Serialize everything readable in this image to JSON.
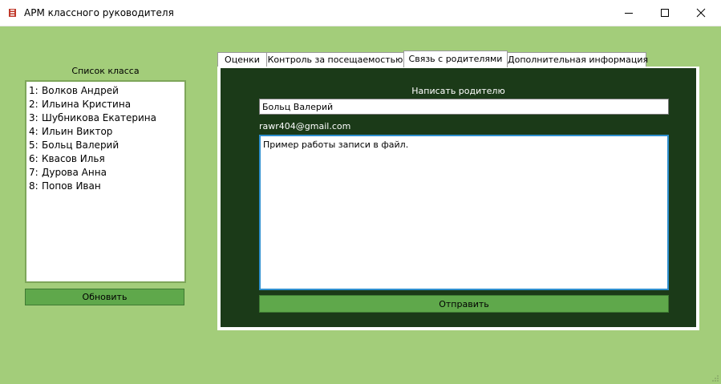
{
  "window": {
    "title": "АРМ классного руководителя",
    "controls": {
      "minimize": "minimize-icon",
      "maximize": "maximize-icon",
      "close": "close-icon"
    }
  },
  "left_panel": {
    "list_title": "Список класса",
    "students": [
      {
        "num": "1:",
        "name": "Волков Андрей"
      },
      {
        "num": "2:",
        "name": "Ильина Кристина"
      },
      {
        "num": "3:",
        "name": "Шубникова Екатерина"
      },
      {
        "num": "4:",
        "name": "Ильин Виктор"
      },
      {
        "num": "5:",
        "name": "Больц Валерий"
      },
      {
        "num": "6:",
        "name": "Квасов Илья"
      },
      {
        "num": "7:",
        "name": "Дурова Анна"
      },
      {
        "num": "8:",
        "name": "Попов Иван"
      }
    ],
    "refresh_label": "Обновить"
  },
  "tabs": [
    {
      "label": "Оценки"
    },
    {
      "label": "Контроль за посещаемостью"
    },
    {
      "label": "Связь с родителями"
    },
    {
      "label": "Дополнительная информация"
    }
  ],
  "active_tab": "Связь с родителями",
  "contact": {
    "title": "Написать родителю",
    "parent_name": "Больц Валерий",
    "email": "rawr404@gmail.com",
    "message": "Пример работы записи в файл.",
    "send_label": "Отправить"
  },
  "colors": {
    "background": "#a3cd7a",
    "panel": "#1b3a18",
    "button": "#5fa84b"
  }
}
